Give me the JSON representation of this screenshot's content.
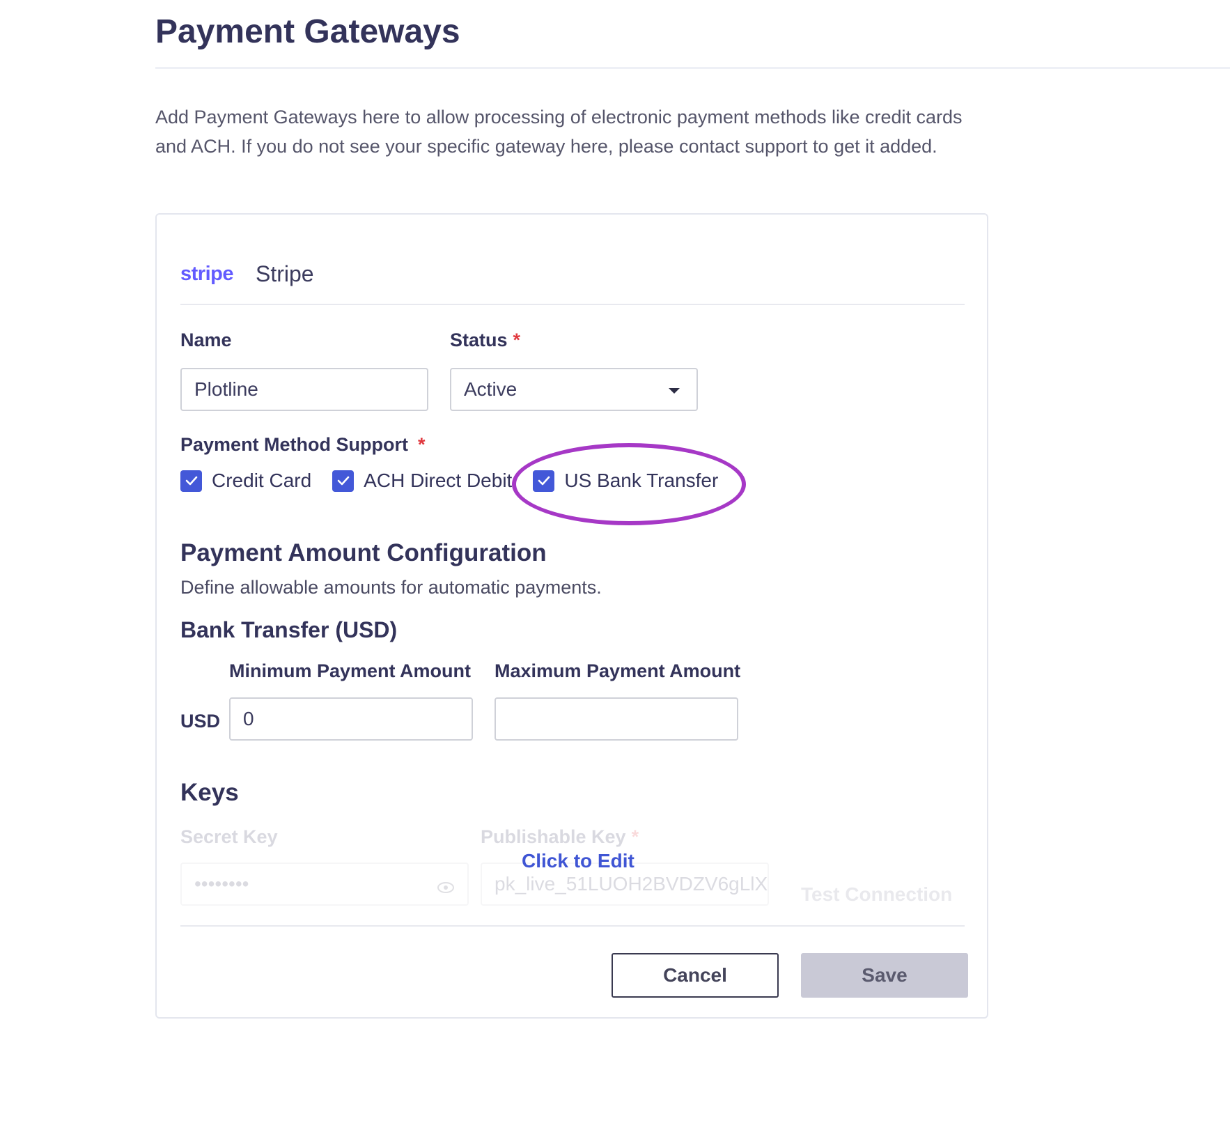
{
  "page": {
    "title": "Payment Gateways",
    "intro": "Add Payment Gateways here to allow processing of electronic payment methods like credit cards and ACH. If you do not see your specific gateway here, please contact support to get it added."
  },
  "gateway": {
    "logo_text": "stripe",
    "logo_color": "#635bff",
    "name": "Stripe"
  },
  "form": {
    "name_label": "Name",
    "name_value": "Plotline",
    "status_label": "Status",
    "status_value": "Active",
    "required_mark": "*",
    "payment_method_label": "Payment Method Support",
    "payment_methods": [
      {
        "label": "Credit Card",
        "checked": true
      },
      {
        "label": "ACH Direct Debit",
        "checked": true
      },
      {
        "label": "US Bank Transfer",
        "checked": true
      }
    ]
  },
  "amount_config": {
    "heading": "Payment Amount Configuration",
    "subtext": "Define allowable amounts for automatic payments.",
    "bank_heading": "Bank Transfer (USD)",
    "currency": "USD",
    "min_label": "Minimum Payment Amount",
    "min_value": "0",
    "max_label": "Maximum Payment Amount",
    "max_value": ""
  },
  "keys": {
    "heading": "Keys",
    "secret_label": "Secret Key",
    "secret_value": "••••••••",
    "publishable_label": "Publishable Key",
    "publishable_value": "pk_live_51LUOH2BVDZV6gLlX",
    "click_to_edit": "Click to Edit",
    "test_connection": "Test Connection"
  },
  "actions": {
    "cancel": "Cancel",
    "save": "Save"
  },
  "colors": {
    "accent": "#4358d8",
    "annotation": "#a638c6",
    "required": "#e0383e",
    "link": "#3f55d4"
  }
}
